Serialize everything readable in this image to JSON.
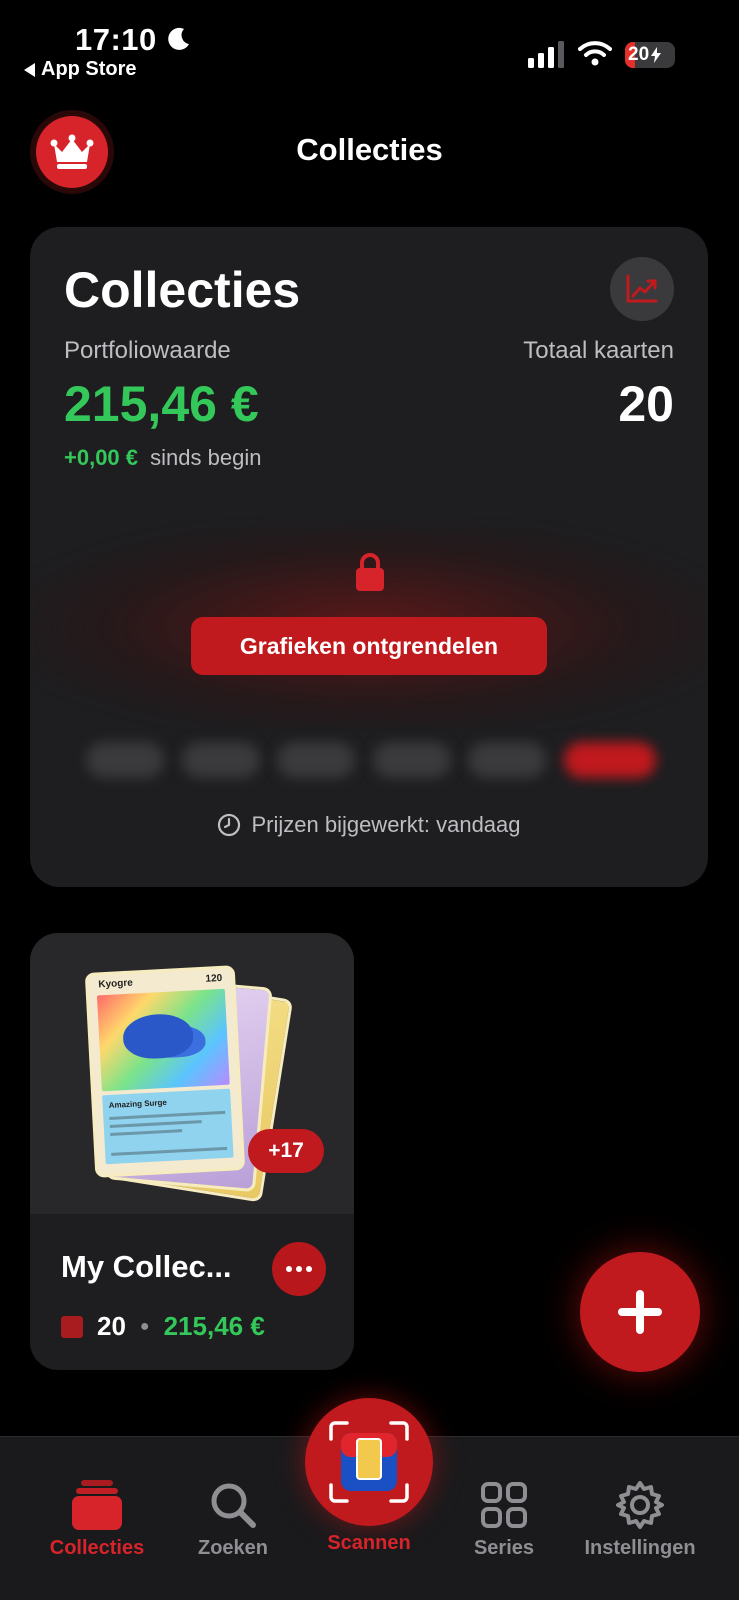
{
  "status_bar": {
    "time": "17:10",
    "back_label": "App Store",
    "battery": "20",
    "icons": [
      "moon-icon",
      "signal-icon",
      "wifi-icon",
      "battery-icon"
    ]
  },
  "header": {
    "title": "Collecties",
    "crown_icon": "crown-icon"
  },
  "summary": {
    "title": "Collecties",
    "portfolio_label": "Portfoliowaarde",
    "portfolio_value": "215,46 €",
    "total_label": "Totaal kaarten",
    "total_value": "20",
    "change_value": "+0,00 €",
    "change_since": "sinds begin",
    "unlock_label": "Grafieken ontgrendelen",
    "updated_text": "Prijzen bijgewerkt: vandaag"
  },
  "collection": {
    "name": "My Collec...",
    "extra_count": "+17",
    "card_count": "20",
    "value": "215,46 €",
    "card_name": "Kyogre",
    "card_hp": "120",
    "card_attack": "Amazing Surge"
  },
  "tabs": [
    {
      "label": "Collecties",
      "icon": "collections-icon",
      "active": true
    },
    {
      "label": "Zoeken",
      "icon": "search-icon",
      "active": false
    },
    {
      "label": "Scannen",
      "icon": "scan-icon",
      "active": false
    },
    {
      "label": "Series",
      "icon": "grid-icon",
      "active": false
    },
    {
      "label": "Instellingen",
      "icon": "gear-icon",
      "active": false
    }
  ],
  "colors": {
    "accent": "#c0191e",
    "positive": "#34c759",
    "background": "#000000",
    "card": "#1e1e20"
  }
}
